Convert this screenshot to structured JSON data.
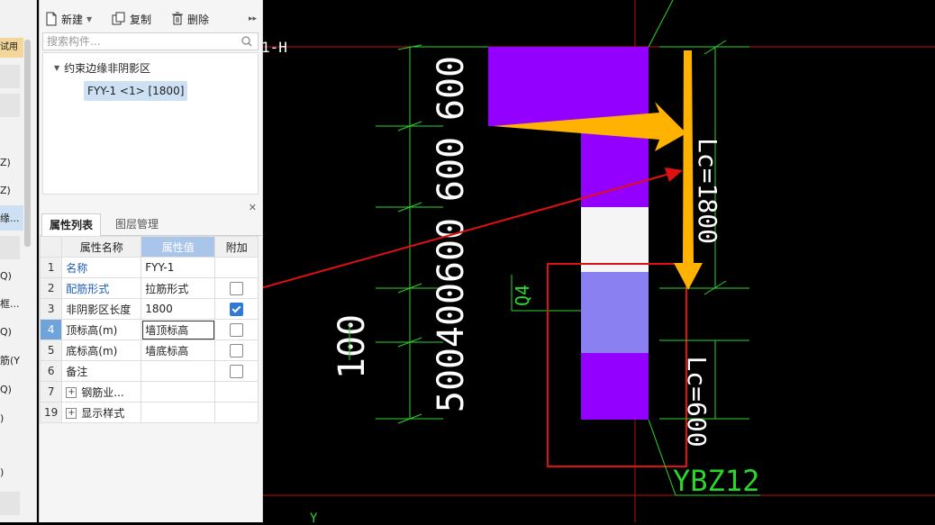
{
  "left_strip": {
    "badge": "试用",
    "items": [
      "Z)",
      "Z)",
      "缘...",
      "Q)",
      "框...",
      "Q)",
      "筋(Y",
      "Q)",
      ")",
      ")"
    ]
  },
  "toolbar": {
    "new_label": "新建",
    "copy_label": "复制",
    "delete_label": "删除"
  },
  "search": {
    "placeholder": "搜索构件..."
  },
  "tree": {
    "group_label": "约束边缘非阴影区",
    "leaf_label": "FYY-1 <1> [1800]"
  },
  "tabs": [
    {
      "label": "属性列表"
    },
    {
      "label": "图层管理"
    }
  ],
  "table": {
    "headers": [
      "属性名称",
      "属性值",
      "附加"
    ],
    "rows": [
      {
        "num": "1",
        "name": "名称",
        "value": "FYY-1"
      },
      {
        "num": "2",
        "name": "配筋形式",
        "value": "拉筋形式"
      },
      {
        "num": "3",
        "name": "非阴影区长度",
        "value": "1800"
      },
      {
        "num": "4",
        "name": "顶标高(m)",
        "value": "墙顶标高"
      },
      {
        "num": "5",
        "name": "底标高(m)",
        "value": "墙底标高"
      },
      {
        "num": "6",
        "name": "备注",
        "value": ""
      },
      {
        "num": "7",
        "name": "钢筋业...",
        "value": ""
      },
      {
        "num": "19",
        "name": "显示样式",
        "value": ""
      }
    ]
  },
  "cad": {
    "axis_label": "1-H",
    "dims_left": [
      "600",
      "600",
      "600",
      "400",
      "500"
    ],
    "dim_100": "100",
    "label_q4": "Q4",
    "lc_1800": "Lc=1800",
    "lc_600": "Lc=600",
    "ybz": "YBZ12",
    "axis_y": "Y"
  },
  "colors": {
    "purple": "#9400ff",
    "light_purple": "#8a80f2",
    "white_block": "#f5f5f5",
    "green_dim": "#2bd62b",
    "red_line": "#e01010",
    "orange_arrow": "#ffb300"
  }
}
